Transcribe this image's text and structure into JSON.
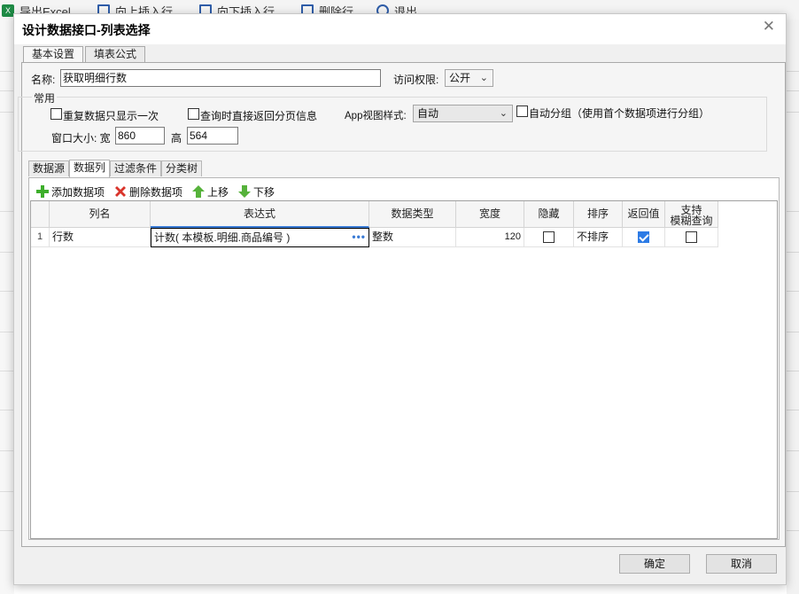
{
  "background": {
    "toolbar": [
      {
        "label": "导出Excel",
        "icon": "excel-icon"
      },
      {
        "label": "向上插入行",
        "icon": "insert-up-icon"
      },
      {
        "label": "向下插入行",
        "icon": "insert-down-icon"
      },
      {
        "label": "删除行",
        "icon": "delete-row-icon"
      },
      {
        "label": "退出",
        "icon": "power-icon"
      }
    ]
  },
  "dialog": {
    "title": "设计数据接口-列表选择",
    "tabs": [
      "基本设置",
      "填表公式"
    ],
    "name_label": "名称:",
    "name_value": "获取明细行数",
    "access_label": "访问权限:",
    "access_value": "公开",
    "common_group": "常用",
    "opt_repeat": "重复数据只显示一次",
    "opt_query_page": "查询时直接返回分页信息",
    "app_view_label": "App视图样式:",
    "app_view_value": "自动",
    "auto_group": "自动分组（使用首个数据项进行分组）",
    "window_size_label": "窗口大小: 宽",
    "width_value": "860",
    "height_label": "高",
    "height_value": "564",
    "inner_tabs": [
      "数据源",
      "数据列",
      "过滤条件",
      "分类树"
    ],
    "toolbar": {
      "add": "添加数据项",
      "delete": "删除数据项",
      "up": "上移",
      "down": "下移"
    },
    "columns": [
      "列名",
      "表达式",
      "数据类型",
      "宽度",
      "隐藏",
      "排序",
      "返回值",
      "支持",
      "模糊查询"
    ],
    "row": {
      "num": "1",
      "name": "行数",
      "expr": "计数( 本模板.明细.商品编号 )",
      "type": "整数",
      "width": "120",
      "hidden": false,
      "sort": "不排序",
      "return": true,
      "fuzzy": false
    },
    "ok": "确定",
    "cancel": "取消"
  },
  "colors": {
    "accent": "#2d7be5",
    "add_green": "#3dae2b",
    "delete_red": "#d9342b",
    "move_green": "#56b23b"
  }
}
